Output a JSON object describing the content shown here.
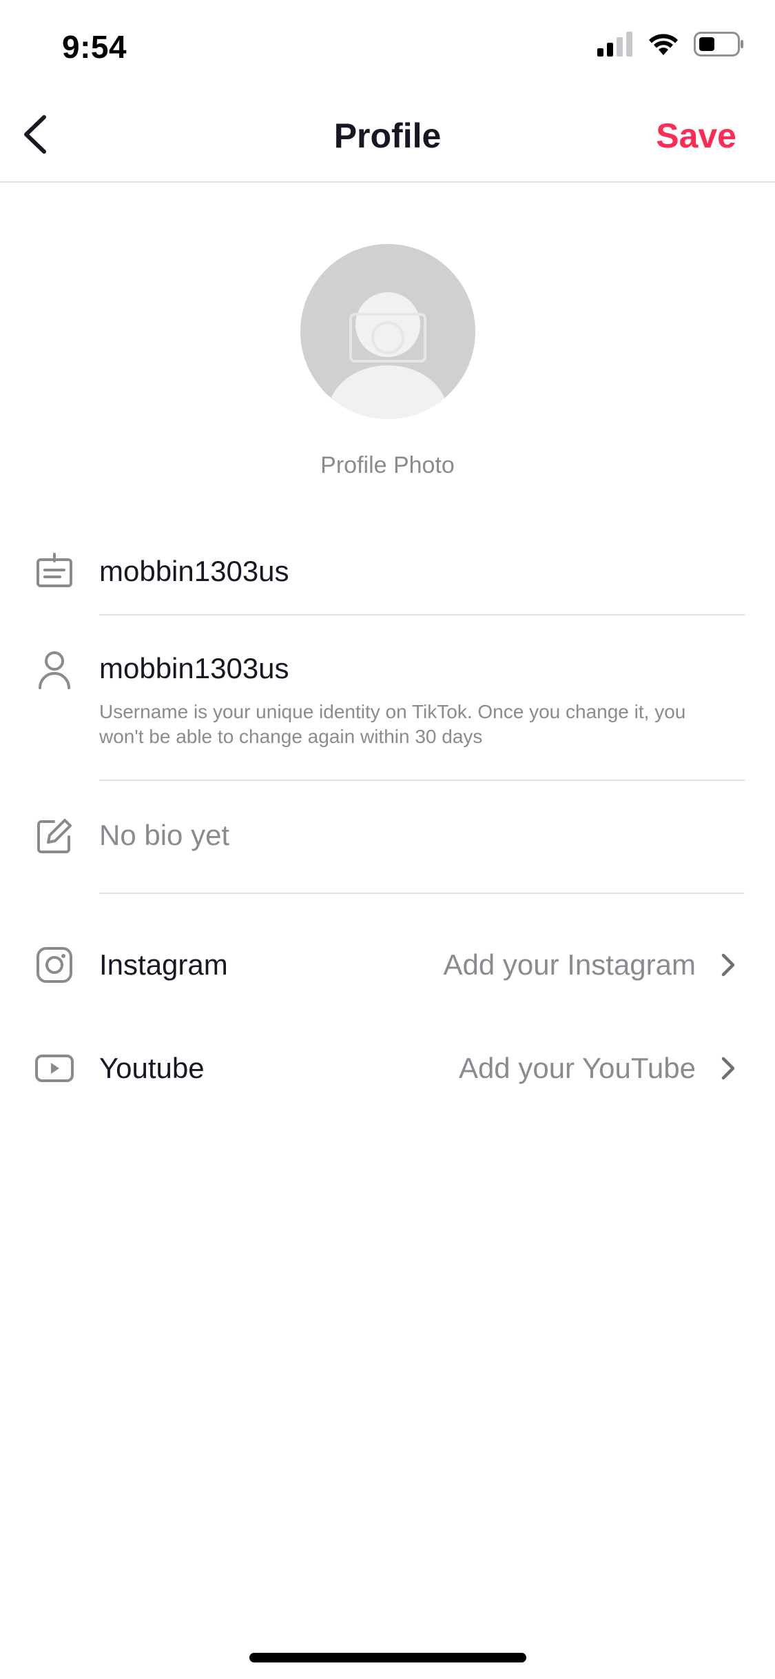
{
  "status_bar": {
    "time": "9:54",
    "icons": [
      "cellular-signal-icon",
      "wifi-icon",
      "battery-icon"
    ]
  },
  "nav": {
    "back_icon": "chevron-left-icon",
    "title": "Profile",
    "save_label": "Save"
  },
  "avatar": {
    "icon": "camera-icon",
    "caption": "Profile Photo"
  },
  "fields": {
    "name": {
      "icon": "id-card-icon",
      "value": "mobbin1303us"
    },
    "username": {
      "icon": "person-icon",
      "value": "mobbin1303us",
      "note_line1": "Username is your unique identity on TikTok. Once you change it, you",
      "note_line2": "won't be able to change again within 30 days"
    },
    "bio": {
      "icon": "edit-icon",
      "placeholder": "No bio yet"
    }
  },
  "links": {
    "instagram": {
      "icon": "instagram-icon",
      "label": "Instagram",
      "value": "Add your Instagram"
    },
    "youtube": {
      "icon": "youtube-icon",
      "label": "Youtube",
      "value": "Add your YouTube"
    }
  },
  "colors": {
    "accent": "#FE2C55",
    "text_primary": "#161823",
    "text_secondary": "#8A8B91",
    "divider": "#E3E3E4"
  }
}
